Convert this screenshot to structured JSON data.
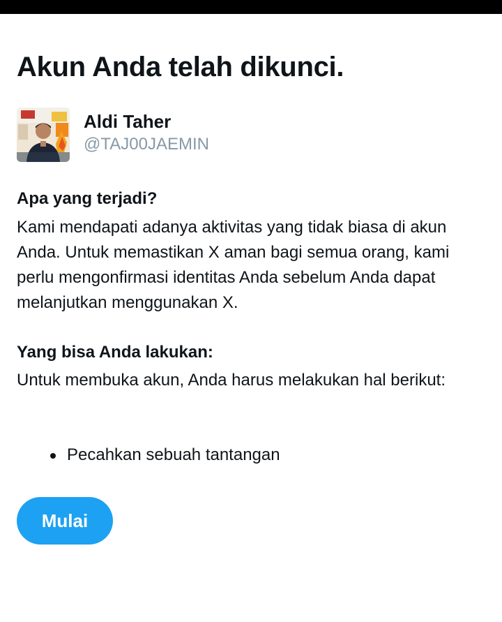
{
  "page": {
    "title": "Akun Anda telah dikunci."
  },
  "profile": {
    "display_name": "Aldi Taher",
    "handle": "@TAJ00JAEMIN",
    "avatar_icon": "profile-photo"
  },
  "what_happened": {
    "heading": "Apa yang terjadi?",
    "body": "Kami mendapati adanya aktivitas yang tidak biasa di akun Anda. Untuk memastikan X aman bagi semua orang, kami perlu mengonfirmasi identitas Anda sebelum Anda dapat melanjutkan menggunakan X."
  },
  "what_to_do": {
    "heading": "Yang bisa Anda lakukan:",
    "body": "Untuk membuka akun, Anda harus melakukan hal berikut:",
    "steps": [
      "Pecahkan sebuah tantangan"
    ]
  },
  "actions": {
    "start_label": "Mulai"
  },
  "colors": {
    "accent": "#1da1f2",
    "text_primary": "#0f1419",
    "text_secondary": "#8899a6",
    "status_bar": "#000000"
  }
}
